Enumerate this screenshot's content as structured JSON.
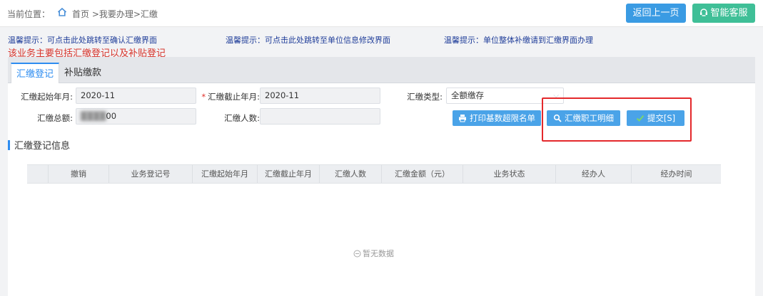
{
  "header": {
    "location_label": "当前位置：",
    "breadcrumb": "首页 >我要办理>汇缴",
    "back_label": "返回上一页",
    "service_label": "智能客服"
  },
  "tips": [
    "温馨提示：可点击此处跳转至确认汇缴界面",
    "温馨提示：可点击此处跳转至单位信息修改界面",
    "温馨提示：单位整体补缴请到汇缴界面办理"
  ],
  "notice": "该业务主要包括汇缴登记以及补贴登记",
  "tabs": [
    {
      "label": "汇缴登记",
      "active": true
    },
    {
      "label": "补贴缴款",
      "active": false
    }
  ],
  "form": {
    "start_label": "汇缴起始年月:",
    "start_value": "2020-11",
    "end_label": "汇缴截止年月:",
    "end_required": "*",
    "end_value": "2020-11",
    "type_label": "汇缴类型:",
    "type_value": "全额缴存",
    "total_label": "汇缴总额:",
    "total_value": "00",
    "people_label": "汇缴人数:",
    "people_value": ""
  },
  "actions": {
    "print_label": "打印基数超限名单",
    "detail_label": "汇缴职工明细",
    "submit_label": "提交[S]"
  },
  "section_title": "汇缴登记信息",
  "table": {
    "columns": [
      "",
      "撤销",
      "业务登记号",
      "汇缴起始年月",
      "汇缴截止年月",
      "汇缴人数",
      "汇缴金额（元）",
      "业务状态",
      "经办人",
      "经办时间"
    ],
    "rows": []
  },
  "empty_text": "暂无数据",
  "icons": [
    "home-icon",
    "headset-icon",
    "printer-icon",
    "search-icon",
    "check-icon",
    "empty-icon"
  ],
  "colors": {
    "primary": "#3a9be3",
    "service": "#3fbf97",
    "tip": "#1f3d99",
    "notice": "#d7342b",
    "highlight": "#e4282b"
  }
}
